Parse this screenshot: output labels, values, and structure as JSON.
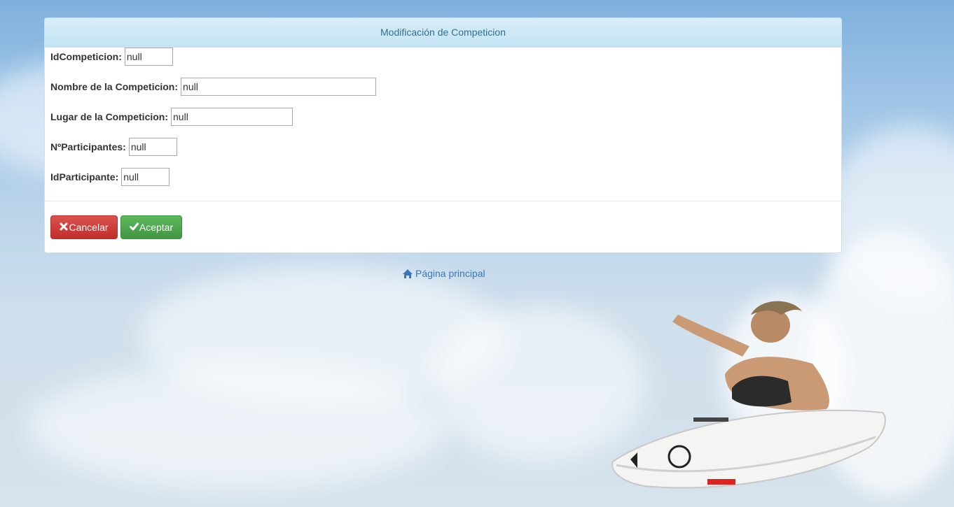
{
  "panel": {
    "title": "Modificación de Competicion"
  },
  "form": {
    "fields": [
      {
        "label": "IdCompeticion:",
        "value": "null"
      },
      {
        "label": "Nombre de la Competicion:",
        "value": "null"
      },
      {
        "label": "Lugar de la Competicion:",
        "value": "null"
      },
      {
        "label": "NºParticipantes:",
        "value": "null"
      },
      {
        "label": "IdParticipante:",
        "value": "null"
      }
    ]
  },
  "buttons": {
    "cancel_label": "Cancelar",
    "cancel_icon": "remove-icon",
    "accept_label": "Aceptar",
    "accept_icon": "ok-icon"
  },
  "footer": {
    "home_label": "Página principal",
    "home_icon": "home-icon"
  },
  "colors": {
    "heading_text": "#31708f",
    "danger": "#d9534f",
    "success": "#5cb85c",
    "link": "#337ab7"
  }
}
